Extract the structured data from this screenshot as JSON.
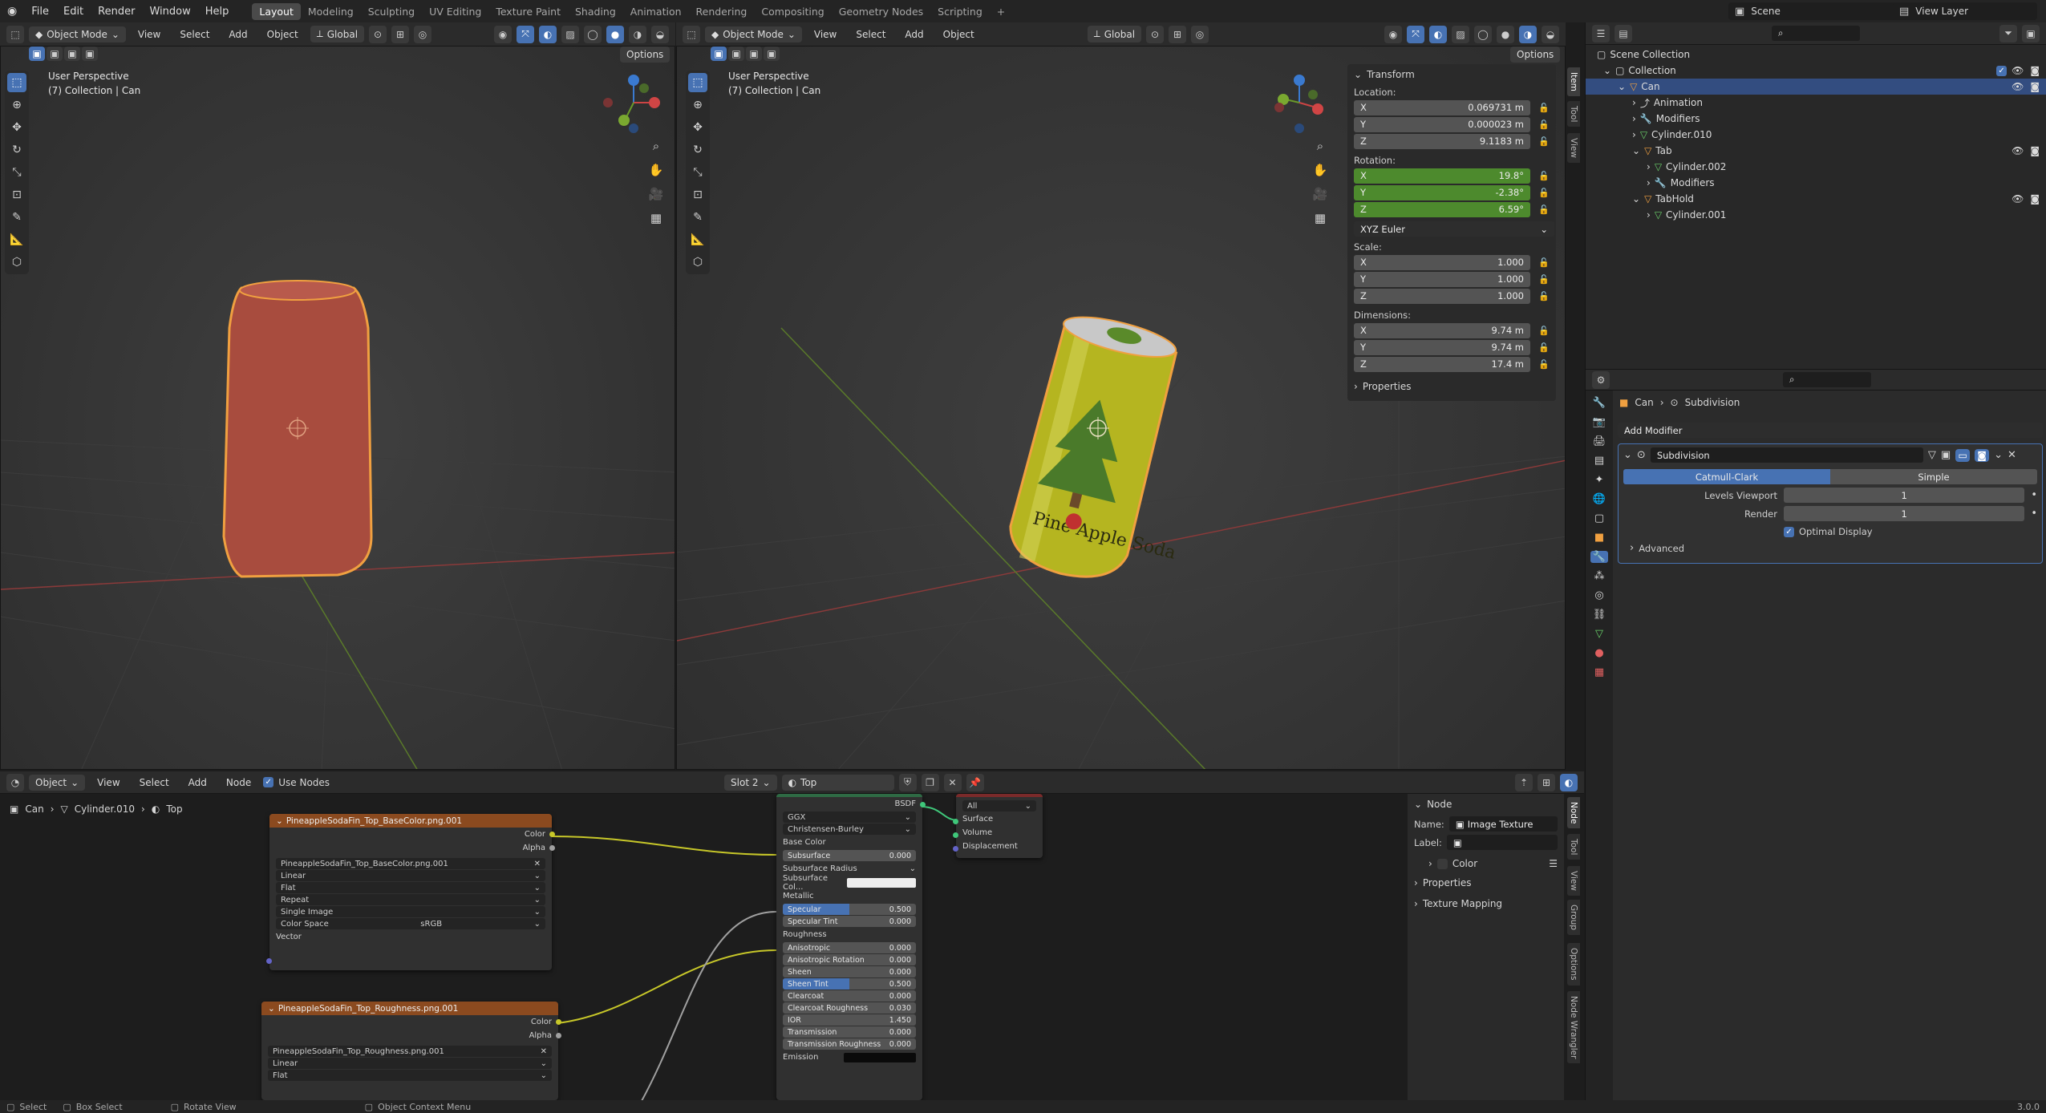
{
  "menu": {
    "file": "File",
    "edit": "Edit",
    "render": "Render",
    "window": "Window",
    "help": "Help"
  },
  "workspaces": [
    "Layout",
    "Modeling",
    "Sculpting",
    "UV Editing",
    "Texture Paint",
    "Shading",
    "Animation",
    "Rendering",
    "Compositing",
    "Geometry Nodes",
    "Scripting"
  ],
  "topright": {
    "scene": "Scene",
    "view_layer": "View Layer"
  },
  "viewport_header": {
    "mode": "Object Mode",
    "view": "View",
    "select": "Select",
    "add": "Add",
    "object": "Object",
    "orientation": "Global",
    "options": "Options"
  },
  "vp_overlay": {
    "perspective": "User Perspective",
    "collection": "(7) Collection | Can"
  },
  "npanel": {
    "transform": "Transform",
    "location": "Location:",
    "rotation": "Rotation:",
    "scale": "Scale:",
    "dimensions": "Dimensions:",
    "x": "X",
    "y": "Y",
    "z": "Z",
    "loc": [
      "0.069731 m",
      "0.000023 m",
      "9.1183 m"
    ],
    "rot": [
      "19.8°",
      "-2.38°",
      "6.59°"
    ],
    "mode": "XYZ Euler",
    "scl": [
      "1.000",
      "1.000",
      "1.000"
    ],
    "dim": [
      "9.74 m",
      "9.74 m",
      "17.4 m"
    ],
    "properties": "Properties",
    "tabs": [
      "Item",
      "Tool",
      "View"
    ]
  },
  "outliner": {
    "rows": [
      "Scene Collection",
      "Collection",
      "Can",
      "Animation",
      "Modifiers",
      "Cylinder.010",
      "Tab",
      "Cylinder.002",
      "Modifiers",
      "TabHold",
      "Cylinder.001"
    ]
  },
  "props": {
    "crumb_obj": "Can",
    "crumb_mod": "Subdivision",
    "add_modifier": "Add Modifier",
    "mod_name": "Subdivision",
    "catmull": "Catmull-Clark",
    "simple": "Simple",
    "levels_viewport": "Levels Viewport",
    "render": "Render",
    "levels_val": "1",
    "render_val": "1",
    "optimal": "Optimal Display",
    "advanced": "Advanced"
  },
  "node_header": {
    "object": "Object",
    "view": "View",
    "select": "Select",
    "add": "Add",
    "node": "Node",
    "use_nodes": "Use Nodes",
    "slot": "Slot 2",
    "material": "Top"
  },
  "node_crumb": {
    "obj": "Can",
    "mesh": "Cylinder.010",
    "mat": "Top"
  },
  "img1": {
    "title": "PineappleSodaFin_Top_BaseColor.png.001",
    "color": "Color",
    "alpha": "Alpha",
    "file": "PineappleSodaFin_Top_BaseColor.png.001",
    "interp": "Linear",
    "proj": "Flat",
    "ext": "Repeat",
    "src": "Single Image",
    "cs_label": "Color Space",
    "cs": "sRGB",
    "vector": "Vector"
  },
  "img2": {
    "title": "PineappleSodaFin_Top_Roughness.png.001",
    "color": "Color",
    "alpha": "Alpha",
    "file": "PineappleSodaFin_Top_Roughness.png.001",
    "interp": "Linear",
    "proj": "Flat"
  },
  "bsdf": {
    "title": "BSDF",
    "dist": "GGX",
    "sss": "Christensen-Burley",
    "base": "Base Color",
    "rows": [
      [
        "Subsurface",
        "0.000",
        0
      ],
      [
        "Subsurface Radius",
        "",
        0
      ],
      [
        "Subsurface Col...",
        "",
        0
      ],
      [
        "Metallic",
        "",
        0
      ],
      [
        "Specular",
        "0.500",
        0.5
      ],
      [
        "Specular Tint",
        "0.000",
        0
      ],
      [
        "Roughness",
        "",
        0
      ],
      [
        "Anisotropic",
        "0.000",
        0
      ],
      [
        "Anisotropic Rotation",
        "0.000",
        0
      ],
      [
        "Sheen",
        "0.000",
        0
      ],
      [
        "Sheen Tint",
        "0.500",
        0.5
      ],
      [
        "Clearcoat",
        "0.000",
        0
      ],
      [
        "Clearcoat Roughness",
        "0.030",
        0
      ],
      [
        "IOR",
        "1.450",
        0
      ],
      [
        "Transmission",
        "0.000",
        0
      ],
      [
        "Transmission Roughness",
        "0.000",
        0
      ],
      [
        "Emission",
        "",
        0
      ]
    ]
  },
  "output": {
    "target": "All",
    "surface": "Surface",
    "volume": "Volume",
    "displacement": "Displacement"
  },
  "node_side": {
    "node": "Node",
    "name_lbl": "Name:",
    "name": "Image Texture",
    "label_lbl": "Label:",
    "color": "Color",
    "properties": "Properties",
    "mapping": "Texture Mapping",
    "tabs": [
      "Node",
      "Tool",
      "View",
      "Group",
      "Options",
      "Node Wrangler"
    ]
  },
  "status": {
    "select": "Select",
    "box": "Box Select",
    "rotate": "Rotate View",
    "ctx": "Object Context Menu",
    "version": "3.0.0"
  },
  "can_label": "Pine Apple Soda"
}
